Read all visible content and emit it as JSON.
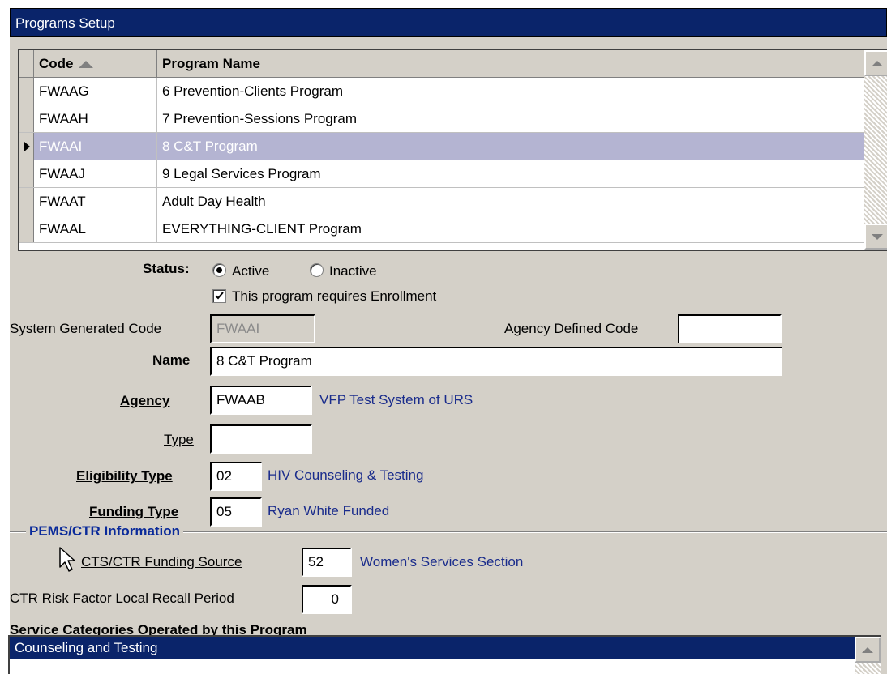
{
  "window": {
    "title": "Programs Setup"
  },
  "grid": {
    "columns": {
      "code": "Code",
      "name": "Program Name"
    },
    "rows": [
      {
        "code": "FWAAG",
        "name": "6 Prevention-Clients Program"
      },
      {
        "code": "FWAAH",
        "name": "7 Prevention-Sessions Program"
      },
      {
        "code": "FWAAI",
        "name": "8 C&T Program"
      },
      {
        "code": "FWAAJ",
        "name": "9 Legal Services Program"
      },
      {
        "code": "FWAAT",
        "name": "Adult Day Health"
      },
      {
        "code": "FWAAL",
        "name": "EVERYTHING-CLIENT Program"
      }
    ],
    "selected_index": 2
  },
  "form": {
    "status_label": "Status:",
    "status_active": "Active",
    "status_inactive": "Inactive",
    "status_value": "Active",
    "enrollment_label": "This program requires Enrollment",
    "enrollment_checked": true,
    "sys_code_label": "System Generated Code",
    "sys_code_value": "FWAAI",
    "agency_code_label": "Agency Defined Code",
    "agency_code_value": "",
    "name_label": "Name",
    "name_value": "8 C&T Program",
    "agency_label": "Agency",
    "agency_value": "FWAAB",
    "agency_desc": "VFP Test System of URS",
    "type_label": "Type",
    "type_value": "",
    "elig_label": "Eligibility Type",
    "elig_value": "02",
    "elig_desc": "HIV Counseling & Testing",
    "funding_label": "Funding Type",
    "funding_value": "05",
    "funding_desc": "Ryan White Funded"
  },
  "pems": {
    "title": "PEMS/CTR Information",
    "cts_label": "CTS/CTR Funding Source",
    "cts_value": "52",
    "cts_desc": "Women's Services Section",
    "recall_label": "CTR Risk Factor Local Recall Period",
    "recall_value": "0"
  },
  "services": {
    "title": "Service Categories Operated by this Program",
    "items": [
      "Counseling and Testing"
    ]
  },
  "colors": {
    "title_bg": "#0a246a",
    "selected_row": "#b4b4d2",
    "link": "#1a2c8c",
    "group_title": "#0a2a9a"
  }
}
